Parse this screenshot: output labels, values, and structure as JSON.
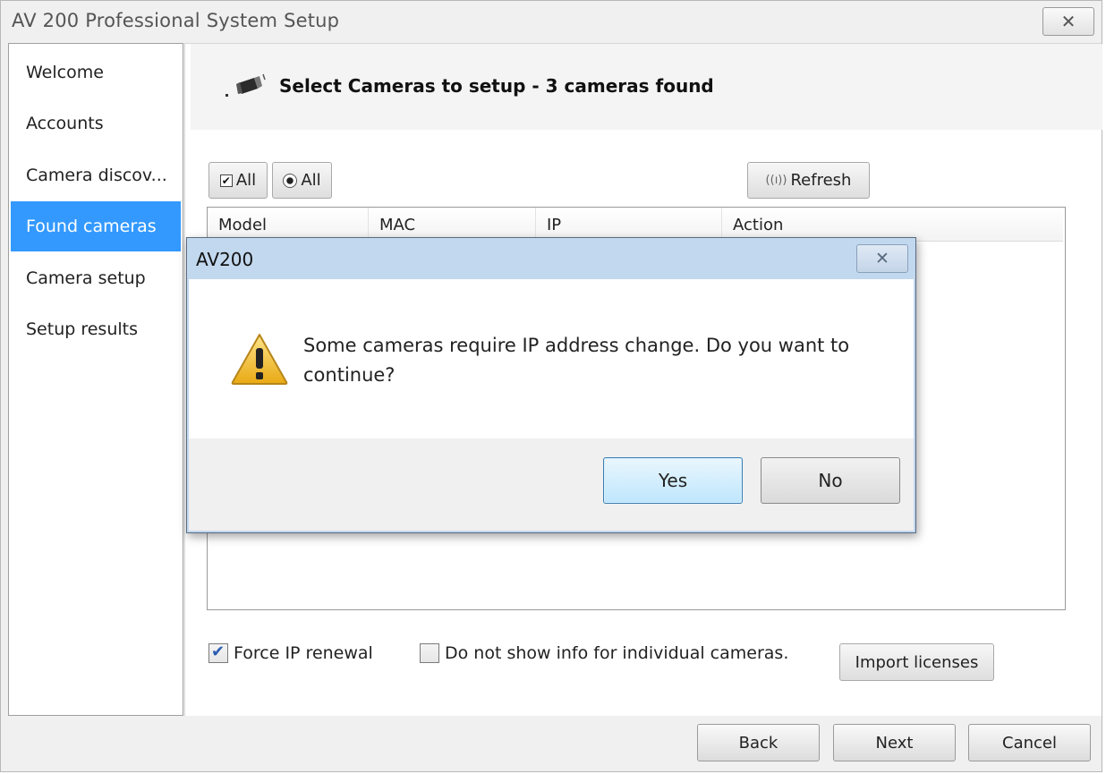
{
  "window": {
    "title": "AV 200 Professional System Setup",
    "close_glyph": "✕"
  },
  "sidebar": {
    "items": [
      {
        "label": "Welcome"
      },
      {
        "label": "Accounts"
      },
      {
        "label": "Camera discov..."
      },
      {
        "label": "Found cameras",
        "active": true
      },
      {
        "label": "Camera setup"
      },
      {
        "label": "Setup results"
      }
    ]
  },
  "header": {
    "title": "Select Cameras to setup - 3 cameras found",
    "icon": "camera-icon"
  },
  "toolbar": {
    "check_all_label": "All",
    "radio_all_label": "All",
    "refresh_label": "Refresh",
    "refresh_icon": "antenna-icon"
  },
  "grid": {
    "columns": [
      "Model",
      "MAC",
      "IP",
      "Action"
    ]
  },
  "options": {
    "force_ip_renewal_label": "Force IP renewal",
    "force_ip_renewal_checked": true,
    "hide_info_label": "Do not show info for individual cameras.",
    "hide_info_checked": false,
    "import_licenses_label": "Import licenses"
  },
  "footer": {
    "back_label": "Back",
    "next_label": "Next",
    "cancel_label": "Cancel"
  },
  "dialog": {
    "title": "AV200",
    "close_glyph": "✕",
    "message": "Some cameras require IP address change. Do you want to continue?",
    "icon": "warning-icon",
    "yes_label": "Yes",
    "no_label": "No"
  },
  "colors": {
    "accent": "#3399ff",
    "dialog_frame": "#c2d8ee",
    "warning": "#f2c42c"
  }
}
